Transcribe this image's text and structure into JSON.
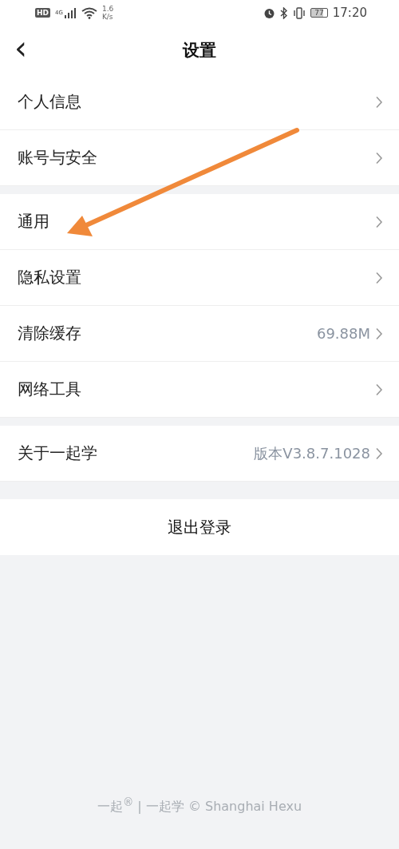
{
  "status_bar": {
    "hd": "HD",
    "network": "4G",
    "speed": "1.6",
    "speed_unit": "K/s",
    "battery": "77",
    "time": "17:20"
  },
  "header": {
    "back": "‹",
    "title": "设置"
  },
  "sections": [
    {
      "items": [
        {
          "label": "个人信息"
        },
        {
          "label": "账号与安全"
        }
      ]
    },
    {
      "items": [
        {
          "label": "通用"
        },
        {
          "label": "隐私设置"
        },
        {
          "label": "清除缓存",
          "value": "69.88M"
        },
        {
          "label": "网络工具"
        }
      ]
    },
    {
      "items": [
        {
          "label": "关于一起学",
          "value": "版本V3.8.7.1028"
        }
      ]
    }
  ],
  "logout": "退出登录",
  "footer": "一起$^{®}$ | 一起学 © Shanghai Hexu"
}
